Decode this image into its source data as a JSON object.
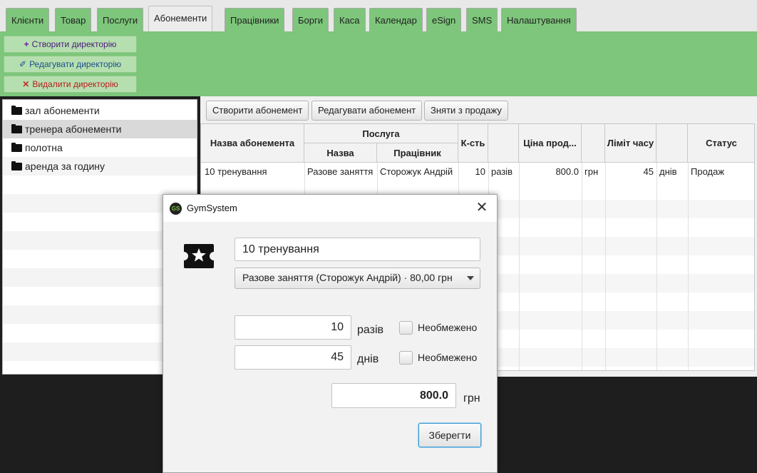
{
  "tabs": [
    {
      "label": "Клієнти"
    },
    {
      "label": "Товар"
    },
    {
      "label": "Послуги"
    },
    {
      "label": "Абонементи"
    },
    {
      "label": "Працівники"
    },
    {
      "label": "Борги"
    },
    {
      "label": "Каса"
    },
    {
      "label": "Календар"
    },
    {
      "label": "eSign"
    },
    {
      "label": "SMS"
    },
    {
      "label": "Налаштування"
    }
  ],
  "selected_tab": "Абонементи",
  "directory_actions": {
    "create": {
      "icon": "+",
      "label": "Створити директорію"
    },
    "edit": {
      "icon": "✐",
      "label": "Редагувати директорію"
    },
    "delete": {
      "icon": "✕",
      "label": "Видалити директорію"
    }
  },
  "directories": [
    {
      "label": "зал абонементи"
    },
    {
      "label": "тренера абонементи"
    },
    {
      "label": "полотна"
    },
    {
      "label": "аренда за годину"
    }
  ],
  "subscription_actions": {
    "create": "Створити абонемент",
    "edit": "Редагувати абонемент",
    "withdraw": "Зняти з продажу"
  },
  "table": {
    "headers": {
      "name": "Назва абонемента",
      "service": "Послуга",
      "service_name": "Назва",
      "service_worker": "Працівник",
      "count": "К-сть",
      "price": "Ціна прод...",
      "time_limit": "Ліміт часу",
      "status": "Статус"
    },
    "rows": [
      {
        "name": "10 тренування",
        "service_name": "Разове заняття",
        "worker": "Сторожук Андрій",
        "count": "10",
        "count_unit": "разів",
        "price": "800.0",
        "currency": "грн",
        "limit": "45",
        "limit_unit": "днів",
        "status": "Продаж"
      }
    ]
  },
  "dialog": {
    "title": "GymSystem",
    "logo_text": "GS",
    "name_value": "10 тренування",
    "service_selected": "Разове заняття (Сторожук Андрій)  ·  80,00 грн",
    "count_value": "10",
    "count_unit": "разів",
    "days_value": "45",
    "days_unit": "днів",
    "unlimited_label": "Необмежено",
    "price_value": "800.0",
    "currency": "грн",
    "save_label": "Зберегти"
  },
  "colors": {
    "accent_green": "#7dc67b",
    "focus_blue": "#3e9bd6"
  }
}
